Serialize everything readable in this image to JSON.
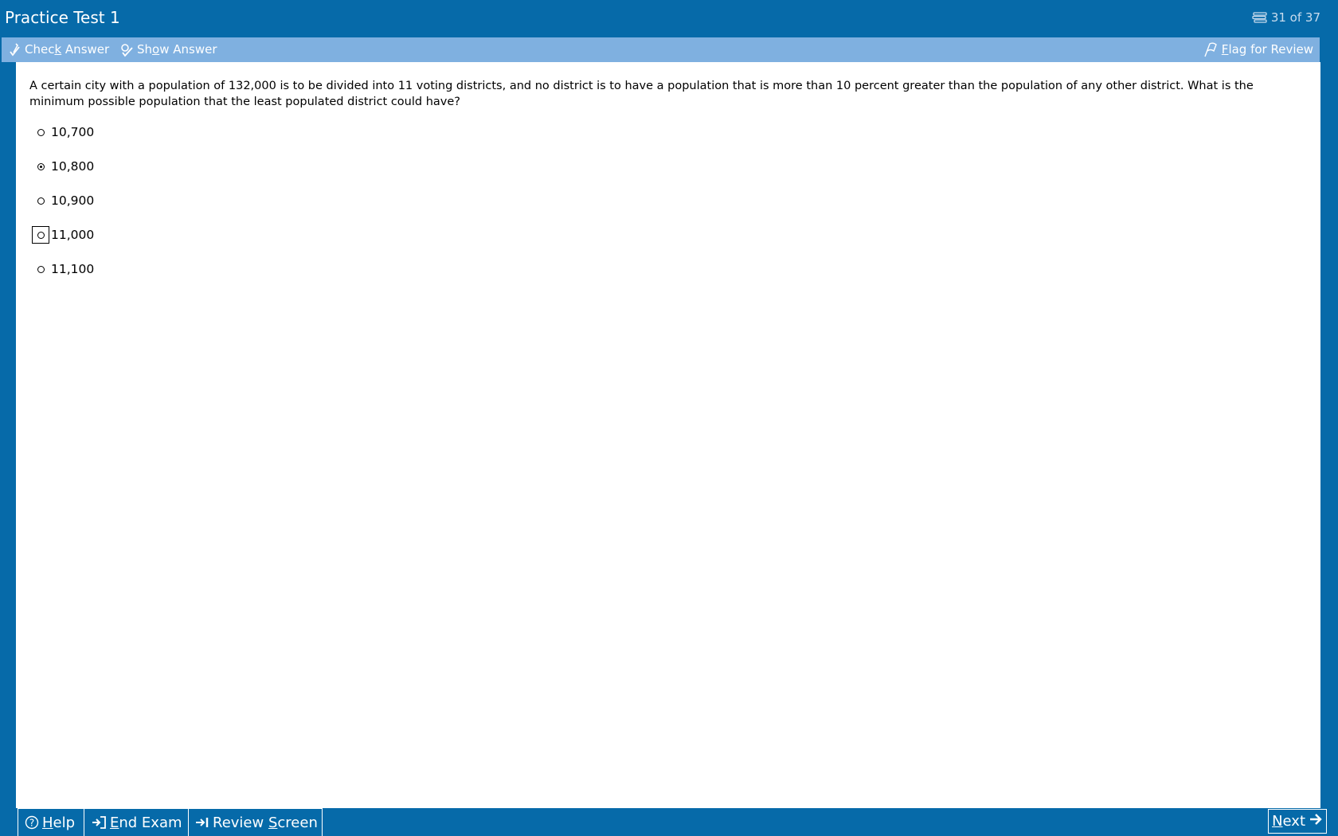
{
  "window": {
    "title": "Practice Test 1",
    "progress": "31 of 37",
    "progress_icon": "list-icon"
  },
  "toolbar": {
    "check_answer": {
      "pre": "Chec",
      "ul": "k",
      "post": " Answer",
      "icon": "check-pen-icon"
    },
    "show_answer": {
      "pre": "Sh",
      "ul": "o",
      "post": "w Answer",
      "icon": "show-answer-icon"
    },
    "flag_for_review": {
      "pre": "",
      "ul": "F",
      "post": "lag for Review",
      "icon": "flag-icon"
    }
  },
  "question": {
    "text": "A certain city with a population of 132,000 is to be divided into 11 voting districts, and no district is to have a population that is more than 10 percent greater than the population of any other district.  What is the minimum possible population that the least populated district could have?",
    "choices": [
      {
        "label": "10,700",
        "selected": false,
        "focused": false
      },
      {
        "label": "10,800",
        "selected": true,
        "focused": false
      },
      {
        "label": "10,900",
        "selected": false,
        "focused": false
      },
      {
        "label": "11,000",
        "selected": false,
        "focused": true
      },
      {
        "label": "11,100",
        "selected": false,
        "focused": false
      }
    ]
  },
  "footer": {
    "help": {
      "pre": "",
      "ul": "H",
      "post": "elp",
      "icon": "help-icon"
    },
    "end_exam": {
      "pre": "",
      "ul": "E",
      "post": "nd Exam",
      "icon": "end-exam-icon"
    },
    "review_screen": {
      "pre": "Review ",
      "ul": "S",
      "post": "creen",
      "icon": "review-screen-icon"
    },
    "next": {
      "pre": "",
      "ul": "N",
      "post": "ext",
      "icon": "arrow-right-icon"
    }
  },
  "colors": {
    "frame": "#066aa9",
    "toolbar": "#7fb0e0",
    "content_bg": "#ffffff"
  }
}
